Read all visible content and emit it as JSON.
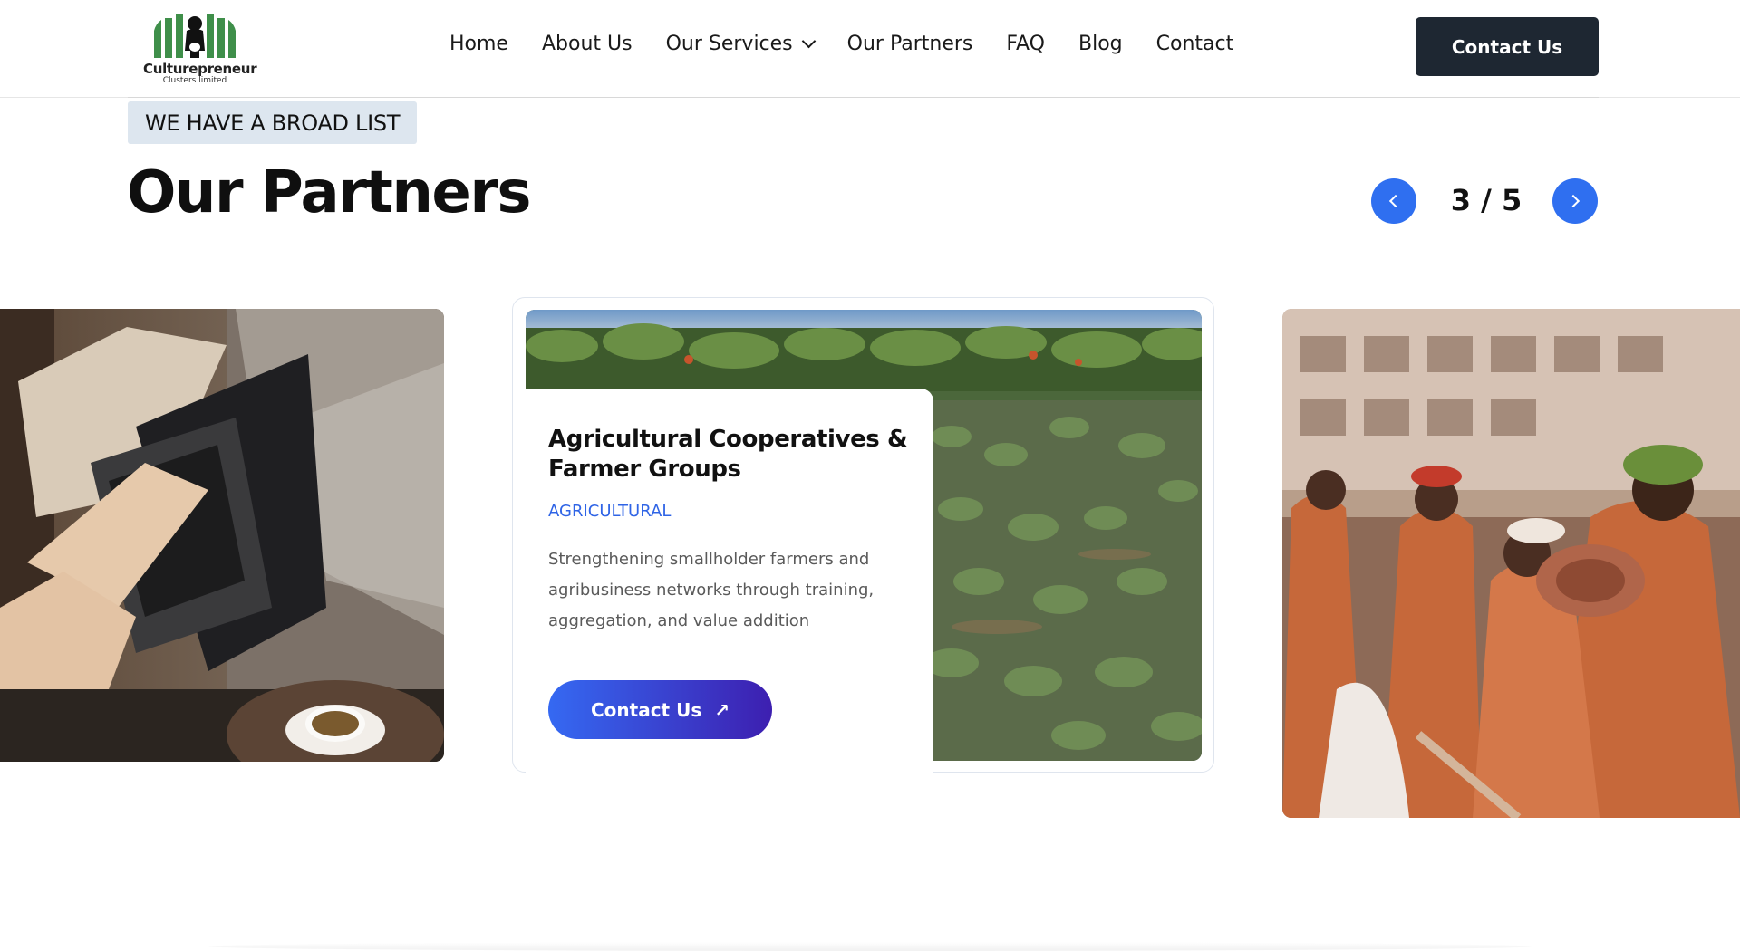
{
  "header": {
    "logo": {
      "name": "Culturepreneur",
      "subtitle": "Clusters limited"
    },
    "nav": [
      {
        "label": "Home"
      },
      {
        "label": "About Us"
      },
      {
        "label": "Our Services",
        "has_dropdown": true
      },
      {
        "label": "Our Partners"
      },
      {
        "label": "FAQ"
      },
      {
        "label": "Blog"
      },
      {
        "label": "Contact"
      }
    ],
    "cta_label": "Contact Us"
  },
  "section": {
    "badge": "WE HAVE A BROAD LIST",
    "title": "Our Partners",
    "pager": {
      "current": 3,
      "total": 5,
      "text": "3 / 5"
    }
  },
  "carousel": {
    "active_card": {
      "title": "Agricultural Cooperatives & Farmer Groups",
      "category": "AGRICULTURAL",
      "description": "Strengthening smallholder farmers and agribusiness networks through training, aggregation, and value addition",
      "cta_label": "Contact Us",
      "cta_icon": "arrow-up-right-icon"
    },
    "side_cards": [
      {
        "image": "laptop-coffee-photo"
      },
      {
        "image": "cultural-performers-photo"
      }
    ]
  },
  "colors": {
    "accent": "#2f6ff0",
    "header_cta": "#1e2732",
    "badge_bg": "#dde6ef",
    "category": "#2f64e6"
  }
}
